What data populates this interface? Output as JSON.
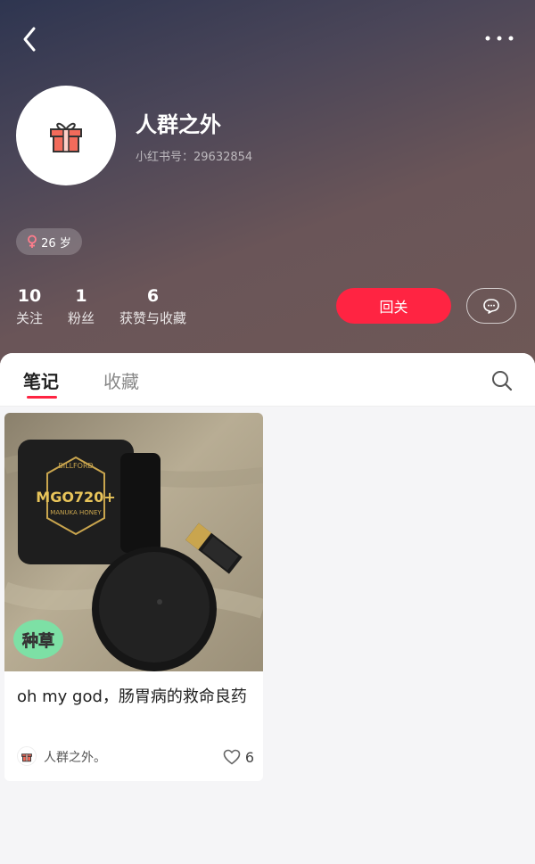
{
  "profile": {
    "name": "人群之外",
    "red_id_label": "小红书号：",
    "red_id": "29632854",
    "age": "26 岁"
  },
  "stats": [
    {
      "num": "10",
      "label": "关注"
    },
    {
      "num": "1",
      "label": "粉丝"
    },
    {
      "num": "6",
      "label": "获赞与收藏"
    }
  ],
  "actions": {
    "follow_back": "回关"
  },
  "tabs": {
    "notes": "笔记",
    "collections": "收藏"
  },
  "note": {
    "badge": "种草",
    "title": "oh my god，肠胃病的救命良药",
    "author": "人群之外。",
    "likes": "6",
    "jar_label_brand": "BILLFORD",
    "jar_label_main": "MGO720+",
    "jar_label_sub": "MANUKA HONEY"
  },
  "colors": {
    "accent": "#ff2442"
  },
  "icons": {
    "back": "chevron-left-icon",
    "more": "more-dots-icon",
    "avatar": "gift-icon",
    "gender": "female-icon",
    "chat": "chat-bubble-icon",
    "search": "search-icon",
    "like": "heart-icon"
  }
}
